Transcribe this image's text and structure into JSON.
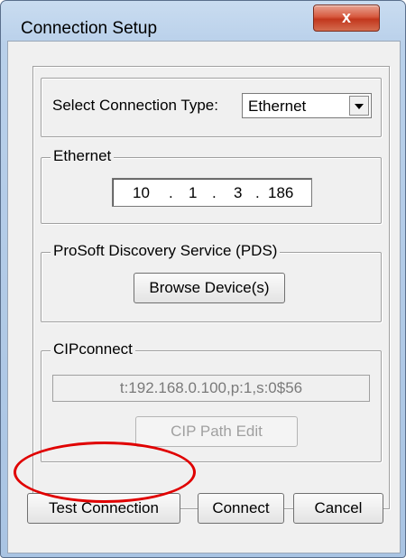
{
  "window": {
    "title": "Connection Setup",
    "close_glyph": "x"
  },
  "connection_type": {
    "label": "Select Connection Type:",
    "selected": "Ethernet"
  },
  "ethernet": {
    "group_label": "Ethernet",
    "octets": [
      "10",
      "1",
      "3",
      "186"
    ],
    "dot": "."
  },
  "pds": {
    "group_label": "ProSoft Discovery Service (PDS)",
    "browse_label": "Browse Device(s)"
  },
  "cipconnect": {
    "group_label": "CIPconnect",
    "path_value": "t:192.168.0.100,p:1,s:0$56",
    "edit_label": "CIP Path Edit"
  },
  "actions": {
    "test_label": "Test Connection",
    "connect_label": "Connect",
    "cancel_label": "Cancel"
  },
  "colors": {
    "highlight": "#e00000",
    "close_button": "#c2371d"
  }
}
